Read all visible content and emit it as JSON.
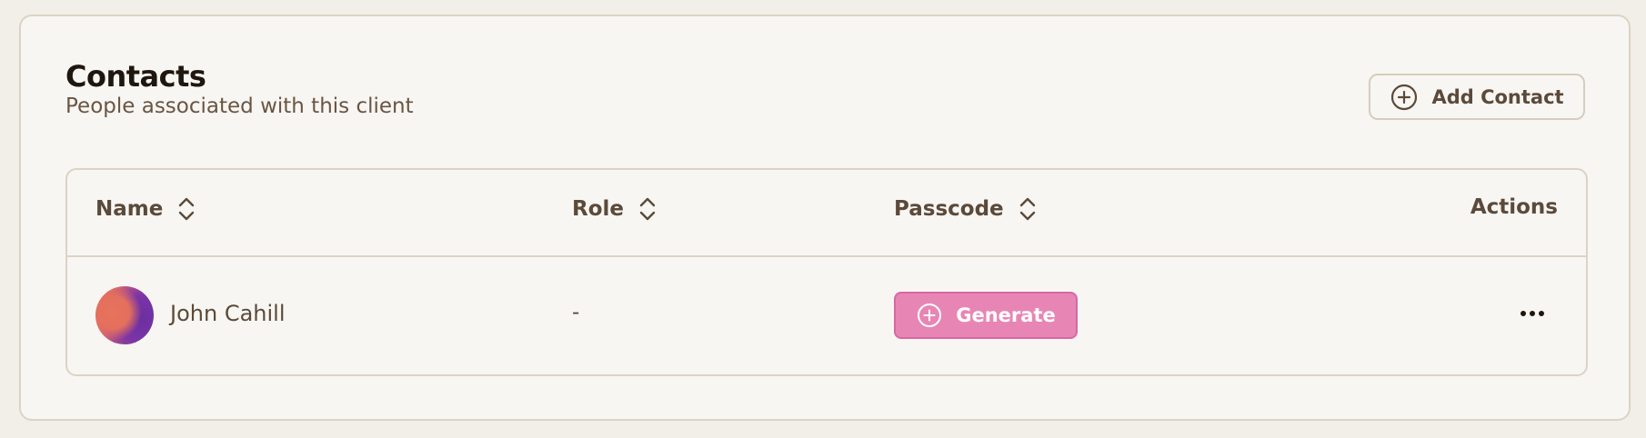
{
  "header": {
    "title": "Contacts",
    "subtitle": "People associated with this client",
    "add_button_label": "Add Contact",
    "add_button_icon": "plus-circle-icon"
  },
  "table": {
    "columns": [
      {
        "label": "Name",
        "sortable": true
      },
      {
        "label": "Role",
        "sortable": true
      },
      {
        "label": "Passcode",
        "sortable": true
      },
      {
        "label": "Actions",
        "sortable": false
      }
    ],
    "rows": [
      {
        "name": "John Cahill",
        "role": "-",
        "passcode_button_label": "Generate",
        "actions_icon": "more-horizontal-icon"
      }
    ]
  },
  "colors": {
    "background": "#f2eee8",
    "card": "#f8f6f2",
    "border": "#dcd3c5",
    "text": "#5b4a3a",
    "title": "#1e160f",
    "accent_pink": "#e786b5"
  }
}
